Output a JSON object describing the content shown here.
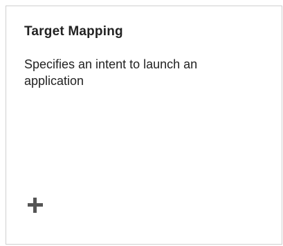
{
  "tile": {
    "title": "Target Mapping",
    "description": "Specifies an intent to launch an application",
    "icon": "plus-icon",
    "icon_color": "#555555",
    "border_color": "#cfcfcf",
    "text_color": "#222222"
  }
}
